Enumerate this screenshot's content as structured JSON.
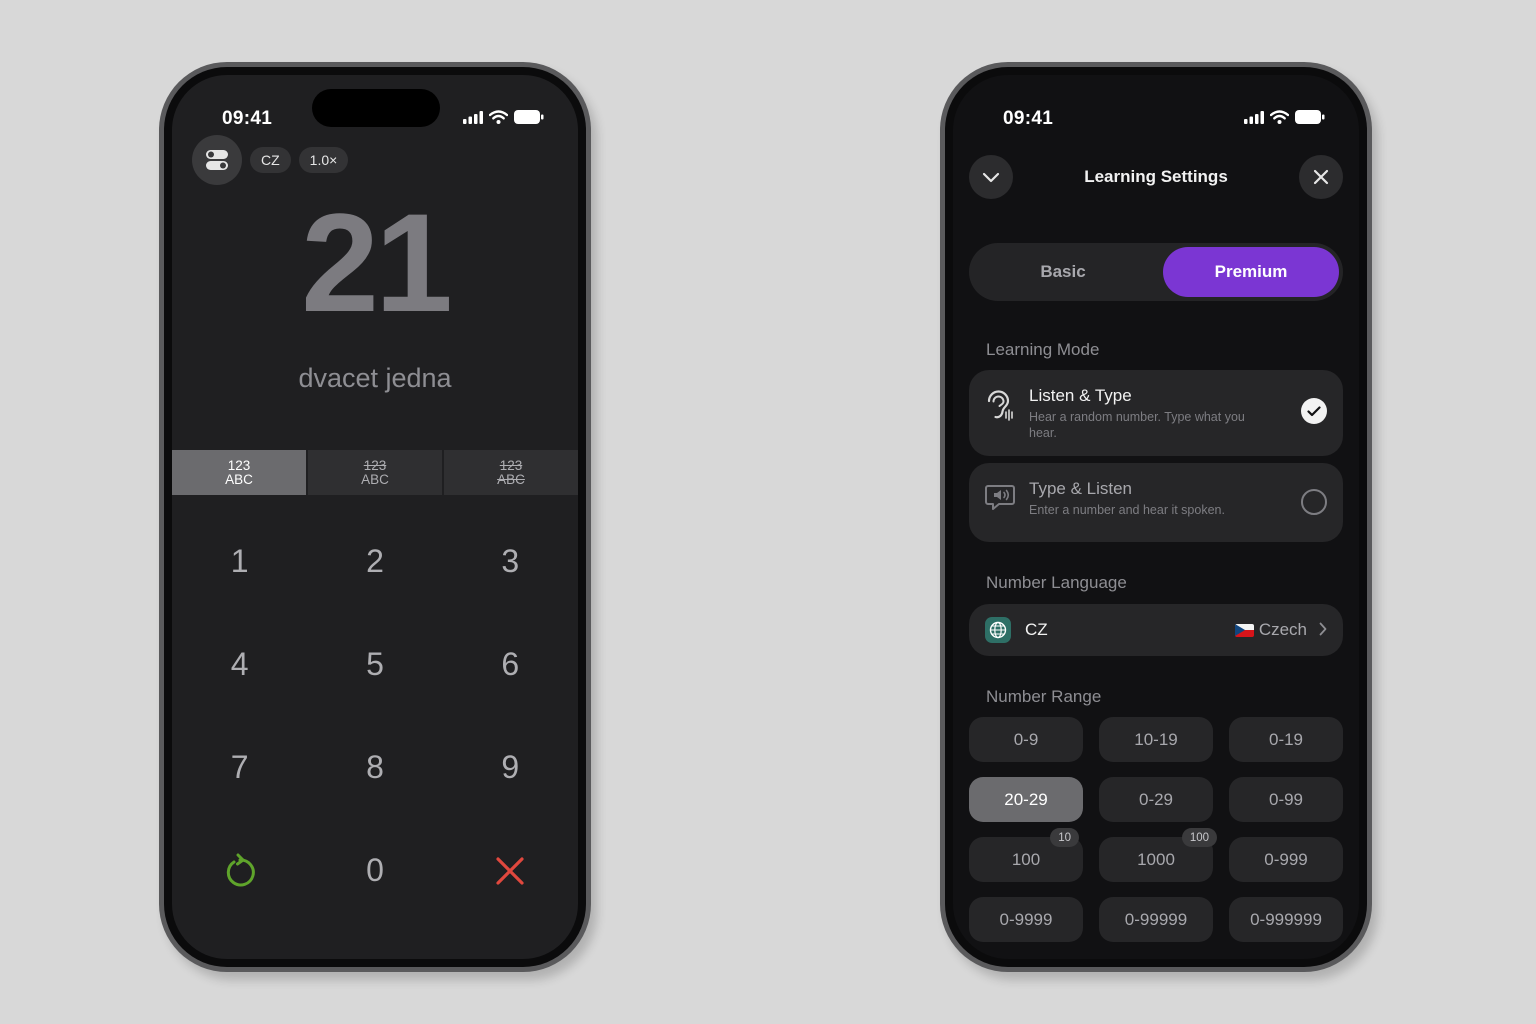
{
  "left_phone": {
    "status": {
      "time": "09:41"
    },
    "controls": {
      "language_chip": "CZ",
      "speed_chip": "1.0×"
    },
    "number": "21",
    "words": "dvacet jedna",
    "display_modes": [
      {
        "line1": "123",
        "line2": "ABC",
        "active": true,
        "strike1": false,
        "strike2": false
      },
      {
        "line1": "123",
        "line2": "ABC",
        "active": false,
        "strike1": true,
        "strike2": false
      },
      {
        "line1": "123",
        "line2": "ABC",
        "active": false,
        "strike1": true,
        "strike2": true
      }
    ],
    "keypad": [
      "1",
      "2",
      "3",
      "4",
      "5",
      "6",
      "7",
      "8",
      "9",
      "",
      "0",
      ""
    ],
    "keypad_icons": {
      "left": "retry-icon",
      "right": "clear-icon"
    }
  },
  "right_phone": {
    "status": {
      "time": "09:41"
    },
    "title": "Learning Settings",
    "tabs": {
      "basic": "Basic",
      "premium": "Premium"
    },
    "learning_mode": {
      "label": "Learning Mode",
      "options": [
        {
          "title": "Listen & Type",
          "desc": "Hear a random number. Type what you hear.",
          "selected": true
        },
        {
          "title": "Type & Listen",
          "desc": "Enter a number and hear it spoken.",
          "selected": false
        }
      ]
    },
    "number_language": {
      "label": "Number Language",
      "code": "CZ",
      "name": "Czech"
    },
    "number_range": {
      "label": "Number Range",
      "options": [
        {
          "label": "0-9"
        },
        {
          "label": "10-19"
        },
        {
          "label": "0-19"
        },
        {
          "label": "20-29",
          "selected": true
        },
        {
          "label": "0-29"
        },
        {
          "label": "0-99"
        },
        {
          "label": "100",
          "badge": "10"
        },
        {
          "label": "1000",
          "badge": "100"
        },
        {
          "label": "0-999"
        },
        {
          "label": "0-9999"
        },
        {
          "label": "0-99999"
        },
        {
          "label": "0-999999"
        }
      ]
    }
  },
  "colors": {
    "accent": "#7b36d3",
    "retry": "#5fa42b",
    "clear": "#e0483e",
    "background": "#d8d8d8"
  }
}
